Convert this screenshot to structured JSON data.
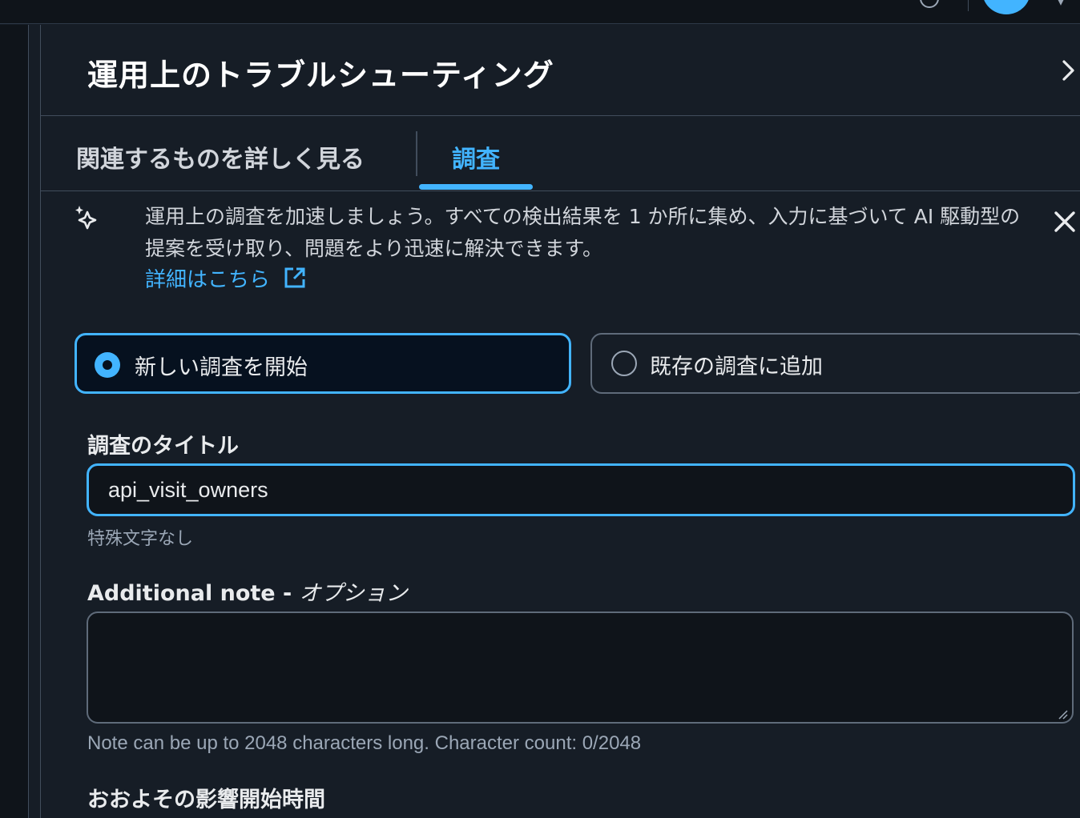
{
  "panel": {
    "title": "運用上のトラブルシューティング"
  },
  "tabs": [
    {
      "label": "関連するものを詳しく見る",
      "selected": false
    },
    {
      "label": "調査",
      "selected": true
    }
  ],
  "info": {
    "text": "運用上の調査を加速しましょう。すべての検出結果を 1 か所に集め、入力に基づいて AI 駆動型の提案を受け取り、問題をより迅速に解決できます。",
    "link_label": "詳細はこちら"
  },
  "options": {
    "new_label": "新しい調査を開始",
    "existing_label": "既存の調査に追加",
    "selected": "new"
  },
  "title_field": {
    "label": "調査のタイトル",
    "value": "api_visit_owners",
    "hint": "特殊文字なし"
  },
  "note_field": {
    "label": "Additional note - ",
    "optional": "オプション",
    "value": "",
    "hint": "Note can be up to 2048 characters long. Character count: 0/2048"
  },
  "impact_field": {
    "label": "おおよその影響開始時間"
  },
  "colors": {
    "accent": "#42b4ff",
    "background": "#161d26",
    "border": "#414d5c"
  }
}
